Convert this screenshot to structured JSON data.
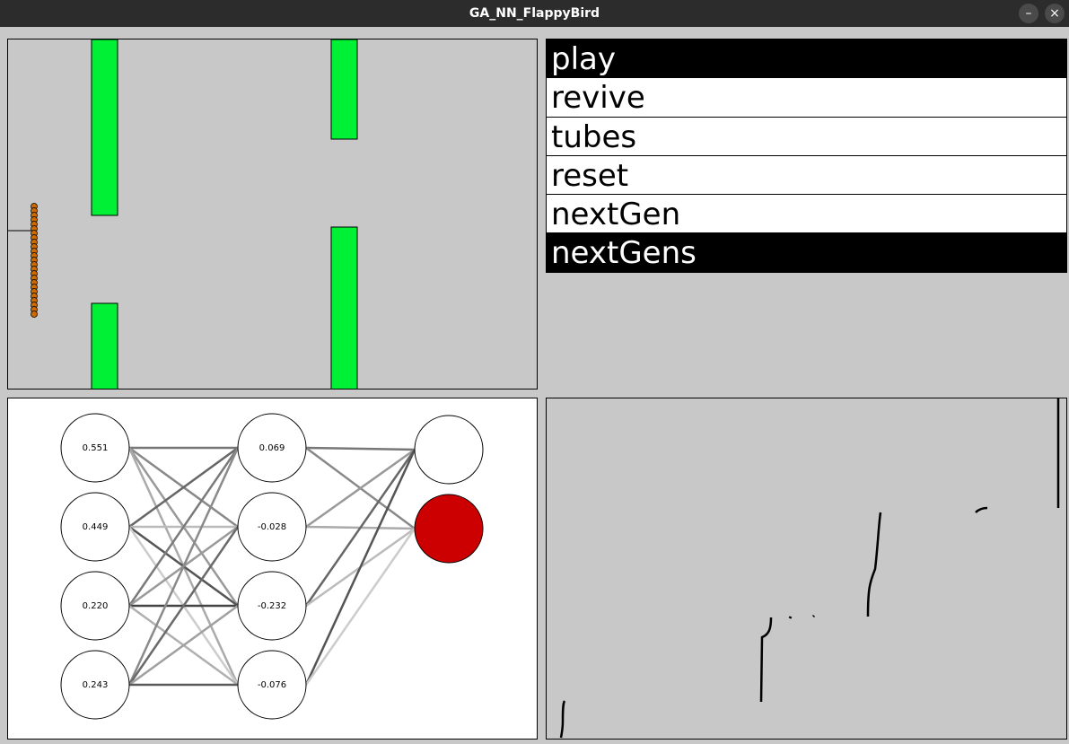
{
  "window": {
    "title": "GA_NN_FlappyBird",
    "minimize_glyph": "–",
    "close_glyph": "×"
  },
  "menu": {
    "items": [
      {
        "label": "play",
        "active": true
      },
      {
        "label": "revive",
        "active": false
      },
      {
        "label": "tubes",
        "active": false
      },
      {
        "label": "reset",
        "active": false
      },
      {
        "label": "nextGen",
        "active": false
      },
      {
        "label": "nextGens",
        "active": true
      }
    ]
  },
  "network": {
    "input_values": [
      "0.551",
      "0.449",
      "0.220",
      "0.243"
    ],
    "hidden_values": [
      "0.069",
      "-0.028",
      "-0.232",
      "-0.076"
    ],
    "output_active": [
      false,
      true
    ]
  },
  "colors": {
    "pipe": "#00f036",
    "bird": "#cc6a00",
    "active_output": "#cc0000",
    "menu_active_bg": "#000000",
    "panel_bg": "#c8c8c8"
  }
}
